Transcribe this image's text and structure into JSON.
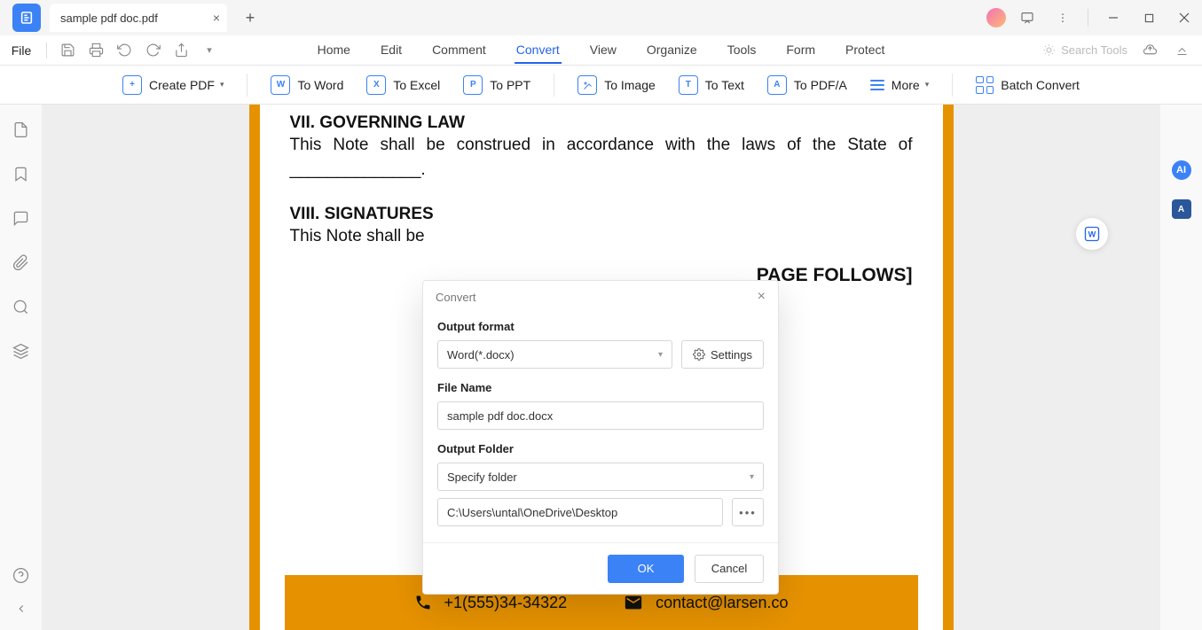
{
  "titlebar": {
    "tab_name": "sample pdf doc.pdf"
  },
  "menubar": {
    "file": "File",
    "items": [
      "Home",
      "Edit",
      "Comment",
      "Convert",
      "View",
      "Organize",
      "Tools",
      "Form",
      "Protect"
    ],
    "active_index": 3,
    "search_placeholder": "Search Tools"
  },
  "ribbon": {
    "create_pdf": "Create PDF",
    "to_word": "To Word",
    "to_excel": "To Excel",
    "to_ppt": "To PPT",
    "to_image": "To Image",
    "to_text": "To Text",
    "to_pdfa": "To PDF/A",
    "more": "More",
    "batch": "Batch Convert"
  },
  "document": {
    "h1": "VII. GOVERNING LAW",
    "body1": "This Note shall be construed in accordance with the laws of the State of ______________.",
    "h2": "VIII. SIGNATURES",
    "body2": "This Note shall be",
    "page_follows_suffix": "PAGE FOLLOWS]",
    "footer_phone": "+1(555)34-34322",
    "footer_email": "contact@larsen.co"
  },
  "dialog": {
    "title": "Convert",
    "output_format_label": "Output format",
    "output_format_value": "Word(*.docx)",
    "settings": "Settings",
    "file_name_label": "File Name",
    "file_name_value": "sample pdf doc.docx",
    "output_folder_label": "Output Folder",
    "output_folder_mode": "Specify folder",
    "output_folder_path": "C:\\Users\\untal\\OneDrive\\Desktop",
    "ok": "OK",
    "cancel": "Cancel"
  }
}
